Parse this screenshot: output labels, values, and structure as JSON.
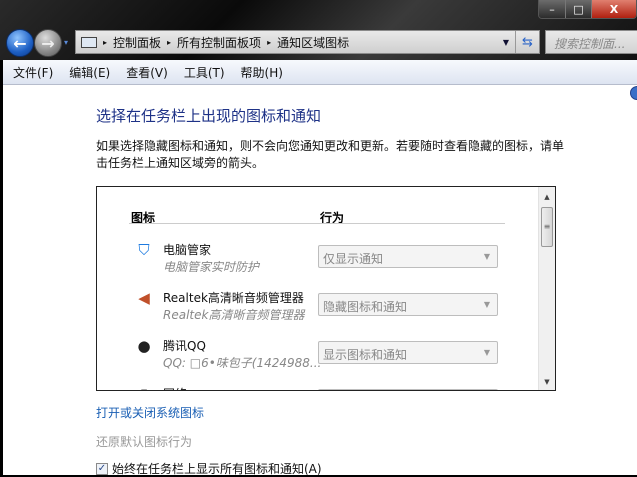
{
  "window": {
    "minimize": "–",
    "maximize": "□",
    "close": "X"
  },
  "nav": {
    "back": "←",
    "forward": "→",
    "dropdown": "▾",
    "breadcrumb": [
      "控制面板",
      "所有控制面板项",
      "通知区域图标"
    ],
    "separator": "▸",
    "address_dropdown": "▼",
    "refresh": "⇆",
    "search_placeholder": "搜索控制面..."
  },
  "menu": [
    "文件(F)",
    "编辑(E)",
    "查看(V)",
    "工具(T)",
    "帮助(H)"
  ],
  "heading": "选择在任务栏上出现的图标和通知",
  "description": "如果选择隐藏图标和通知，则不会向您通知更改和更新。若要随时查看隐藏的图标，请单击任务栏上通知区域旁的箭头。",
  "table": {
    "col_icon": "图标",
    "col_behavior": "行为",
    "rows": [
      {
        "name": "电脑管家",
        "sub": "电脑管家实时防护",
        "behavior": "仅显示通知",
        "icon": "shield-icon"
      },
      {
        "name": "Realtek高清晰音频管理器",
        "sub": "Realtek高清晰音频管理器",
        "behavior": "隐藏图标和通知",
        "icon": "speaker-icon"
      },
      {
        "name": "腾讯QQ",
        "sub": "QQ: □6•味包子(1424988...",
        "behavior": "显示图标和通知",
        "icon": "qq-penguin-icon"
      },
      {
        "name": "网络",
        "sub": "",
        "behavior": "",
        "icon": "network-icon"
      }
    ]
  },
  "links": {
    "system_icons": "打开或关闭系统图标",
    "restore_default": "还原默认图标行为"
  },
  "checkbox": {
    "label": "始终在任务栏上显示所有图标和通知(A)",
    "checked": true,
    "mark": "✓"
  },
  "colors": {
    "heading": "#1e3287",
    "link": "#1a5fb4"
  }
}
